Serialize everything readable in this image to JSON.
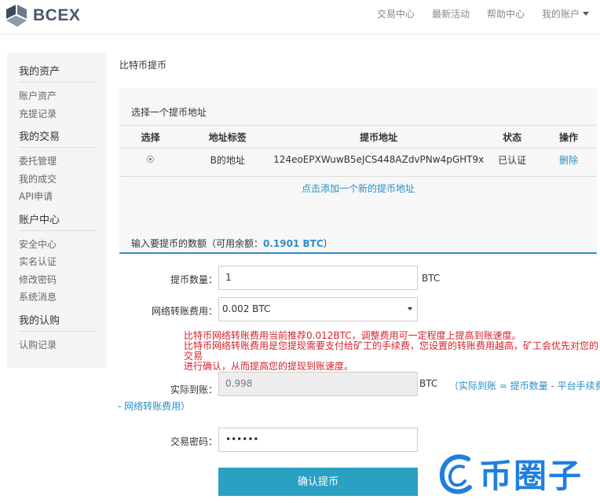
{
  "brand": {
    "name": "BCEX"
  },
  "nav": {
    "items": [
      "交易中心",
      "最新活动",
      "帮助中心"
    ],
    "account": "我的账户"
  },
  "sidebar": {
    "groups": [
      {
        "title": "我的资产",
        "items": [
          "账户资产",
          "充提记录"
        ]
      },
      {
        "title": "我的交易",
        "items": [
          "委托管理",
          "我的成交",
          "API申请"
        ]
      },
      {
        "title": "账户中心",
        "items": [
          "安全中心",
          "实名认证",
          "修改密码",
          "系统消息"
        ]
      },
      {
        "title": "我的认购",
        "items": [
          "认购记录"
        ]
      }
    ]
  },
  "page": {
    "title": "比特币提币"
  },
  "address_panel": {
    "title": "选择一个提币地址",
    "columns": [
      "选择",
      "地址标签",
      "提币地址",
      "状态",
      "操作"
    ],
    "rows": [
      {
        "label": "B的地址",
        "address": "124eoEPXWuwB5eJCS448AZdvPNw4pGHT9x",
        "status": "已认证",
        "action": "删除"
      }
    ],
    "add_link": "点击添加一个新的提币地址"
  },
  "amount_panel": {
    "title_prefix": "输入要提币的数额（可用余额：",
    "balance": "0.1901 BTC",
    "title_suffix": "）",
    "amount_label": "提币数量：",
    "amount_value": "1",
    "unit": "BTC",
    "fee_label": "网络转账费用：",
    "fee_value": "0.002 BTC",
    "warning_lines": [
      "比特币网络转账费用当前推荐0.012BTC，调整费用可一定程度上提高到账速度。",
      "比特币网络转账费用是您提现需要支付给矿工的手续费，您设置的转账费用越高，矿工会优先对您的交易",
      "进行确认，从而提高您的提现到账速度。"
    ],
    "actual_label": "实际到账：",
    "actual_value": "0.998",
    "formula_part1": "（实际到账 = 提币数量 - 平台手续费",
    "formula_part2": "- 网络转账费用）",
    "password_label": "交易密码：",
    "password_value": "••••••",
    "submit_label": "确认提币"
  },
  "watermark": {
    "text": "币圈子"
  },
  "colors": {
    "accent": "#2a8fc7",
    "button": "#2aa1c3",
    "warning": "#d9202a",
    "watermark": "#1f7fe0"
  }
}
